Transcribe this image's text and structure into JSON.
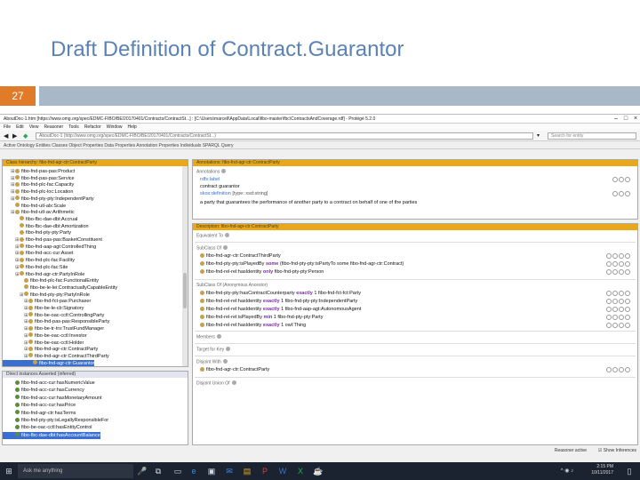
{
  "slide": {
    "title": "Draft Definition of Contract.Guarantor",
    "number": "27"
  },
  "window": {
    "title": "AboutDoc-1.htm [https://www.omg.org/spec/EDMC-FIBO/BE/20170401/Contracts/ContractSt...] : [C:\\Users\\marcell\\AppData\\Local\\fibo-master\\fbc\\ContractsAndCoverage.rdf] - Protégé 5.2.0",
    "menu": [
      "File",
      "Edit",
      "View",
      "Reasoner",
      "Tools",
      "Refactor",
      "Window",
      "Help"
    ],
    "url": "AboutDoc-1 (http://www.omg.org/spec/EDMC-FIBO/BE/20170401/Contracts/ContractSt...)",
    "search_placeholder": "Search for entity",
    "tabs_line": "Active Ontology  Entities  Classes  Object Properties  Data Properties  Annotation Properties  Individuals  SPARQL Query"
  },
  "class_hierarchy": {
    "header": "Class hierarchy: fibo-fnd-agr-ctr:ContractParty",
    "items": [
      {
        "label": "fibo-fnd-pas-pas:Product",
        "expandable": true
      },
      {
        "label": "fibo-fnd-pas-pas:Service",
        "expandable": true
      },
      {
        "label": "fibo-fnd-plc-fac:Capacity",
        "expandable": true
      },
      {
        "label": "fibo-fnd-plc-loc:Location",
        "expandable": true
      },
      {
        "label": "fibo-fnd-pty-pty:IndependentParty",
        "expandable": true
      },
      {
        "label": "fibo-fnd-utl-alx:Scale",
        "expandable": false
      },
      {
        "label": "fibo-fnd-utl-av:Arithmetic",
        "expandable": true
      },
      {
        "label": "fibo-fbc-dae-dbt:Accrual",
        "expandable": false
      },
      {
        "label": "fibo-fbc-dae-dbt:Amortization",
        "expandable": false
      },
      {
        "label": "fibo-fnd-pty-pty:Party",
        "expandable": false
      },
      {
        "label": "fibo-fnd-pas-pas:BasketConstituent",
        "expandable": true
      },
      {
        "label": "fibo-fnd-aap-agt:ControlledThing",
        "expandable": true
      },
      {
        "label": "fibo-fnd-acc-cur:Asset",
        "expandable": true
      },
      {
        "label": "fibo-fnd-plc-fac:Facility",
        "expandable": true
      },
      {
        "label": "fibo-fnd-plc-fac:Site",
        "expandable": true
      },
      {
        "label": "fibo-fnd-agr-ctr:PartyInRole",
        "expandable": true
      },
      {
        "label": "fibo-fnd-plc-fac:FunctionalEntity",
        "expandable": false
      },
      {
        "label": "fibo-be-le-lei:ContractuallyCapableEntity",
        "expandable": false
      },
      {
        "label": "fibo-fnd-pty-pty:PartyInRole",
        "expandable": true
      },
      {
        "label": "fibo-fnd-fct-pas:Purchaser",
        "expandable": true
      },
      {
        "label": "fibo-be-le-cb:Signatory",
        "expandable": true
      },
      {
        "label": "fibo-be-oac-cctl:ControllingParty",
        "expandable": true
      },
      {
        "label": "fibo-fnd-pas-pas:ResponsibleParty",
        "expandable": true
      },
      {
        "label": "fibo-be-tr-trs:TrustFundManager",
        "expandable": true
      },
      {
        "label": "fibo-be-oac-cctl:Investor",
        "expandable": true
      },
      {
        "label": "fibo-be-oac-cctl:Holder",
        "expandable": true
      },
      {
        "label": "fibo-fnd-agr-ctr:ContractParty",
        "expandable": true
      },
      {
        "label": "fibo-fnd-agr-ctr:ContractThirdParty",
        "expandable": true
      },
      {
        "label": "fibo-fnd-agr-ctr:Guarantor",
        "expandable": false,
        "selected": true
      }
    ]
  },
  "data_property_hierarchy": {
    "header": "Direct instances  Asserted  (inferred)",
    "items": [
      {
        "label": "fibo-fnd-acc-cur:hasNumericValue"
      },
      {
        "label": "fibo-fnd-acc-cur:hasCurrency"
      },
      {
        "label": "fibo-fnd-acc-cur:hasMonetaryAmount"
      },
      {
        "label": "fibo-fnd-acc-cur:hasPrice"
      },
      {
        "label": "fibo-fnd-agr-ctr:hasTerms"
      },
      {
        "label": "fibo-fnd-pty-pty:isLegallyResponsibleFor"
      },
      {
        "label": "fibo-be-oac-cctl:hasEntityControl"
      },
      {
        "label": "fibo-fbc-dae-dbt:hasAccountBalance",
        "selected": true
      }
    ]
  },
  "annotations": {
    "header": "Annotations: fibo-fnd-agr-ctr:ContractParty",
    "section": "Annotations",
    "items": [
      {
        "prop": "rdfs:label",
        "value": ""
      },
      {
        "prop": "",
        "value": "contract guarantor"
      },
      {
        "prop": "skos:definition",
        "value": "[type: xsd:string]"
      },
      {
        "prop": "",
        "value": "a party that guarantees the performance of another party to a contract on behalf of one of the parties"
      }
    ]
  },
  "description": {
    "header": "Description: fibo-fnd-agr-ctr:ContractParty",
    "equivalent_label": "Equivalent To",
    "subclass_label": "SubClass Of",
    "subclass_items": [
      {
        "pre": "fibo-fnd-agr-ctr:ContractThirdParty",
        "kw": "",
        "post": ""
      },
      {
        "pre": "fibo-fnd-pty-pty:isPlayedBy ",
        "kw": "some",
        "post": " (fibo-fnd-pty-pty:isPartyTo some fibo-fnd-agr-ctr:Contract)"
      },
      {
        "pre": "fibo-fnd-rel-rel:hasIdentity ",
        "kw": "only",
        "post": " fibo-fnd-pty-pty:Person"
      }
    ],
    "general_label": "SubClass Of (Anonymous Ancestor)",
    "general_items": [
      {
        "pre": "fibo-fnd-pty-pty:hasContractCounterparty ",
        "kw": "exactly",
        "post": " 1 fibo-fnd-fct-fct:Party"
      },
      {
        "pre": "fibo-fnd-rel-rel:hasIdentity ",
        "kw": "exactly",
        "post": " 1 fibo-fnd-pty-pty:IndependentParty"
      },
      {
        "pre": "fibo-fnd-rel-rel:hasIdentity ",
        "kw": "exactly",
        "post": " 1 fibo-fnd-aap-agt:AutonomousAgent"
      },
      {
        "pre": "fibo-fnd-rel-rel:isPlayedBy ",
        "kw": "min",
        "post": " 1 fibo-fnd-pty-pty:Party"
      },
      {
        "pre": "fibo-fnd-rel-rel:hasIdentity ",
        "kw": "exactly",
        "post": " 1 owl:Thing"
      }
    ],
    "members_label": "Members",
    "target_label": "Target for Key",
    "disjoint_label": "Disjoint With",
    "disjoint_items": [
      {
        "pre": "fibo-fnd-agr-ctr:ContractParty",
        "kw": "",
        "post": ""
      }
    ],
    "disjoint_union_label": "Disjoint Union Of"
  },
  "status": {
    "reasoner": "Reasoner active",
    "inferences": "Show Inferences"
  },
  "taskbar": {
    "search": "Ask me anything",
    "time": "2:15 PM",
    "date": "10/11/2017"
  }
}
